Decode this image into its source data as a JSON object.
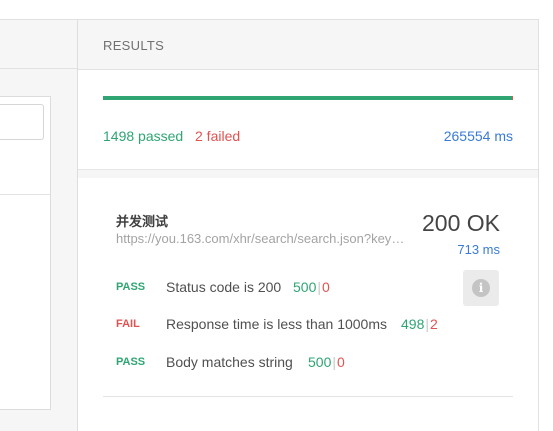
{
  "results": {
    "title": "RESULTS",
    "passed": 1498,
    "failed": 2,
    "passed_text": "1498 passed",
    "failed_text": "2 failed",
    "total_time": "265554 ms",
    "pass_fraction": 0.9987
  },
  "request": {
    "name": "并发测试",
    "url": "https://you.163.com/xhr/search/search.json?keyword=...",
    "status": "200 OK",
    "time": "713 ms",
    "tests": [
      {
        "label": "PASS",
        "name": "Status code is 200",
        "pass_count": "500",
        "fail_count": "0"
      },
      {
        "label": "FAIL",
        "name": "Response time is less than 1000ms",
        "pass_count": "498",
        "fail_count": "2"
      },
      {
        "label": "PASS",
        "name": "Body matches string",
        "pass_count": "500",
        "fail_count": "0"
      }
    ]
  },
  "icons": {
    "info": "info-icon"
  },
  "colors": {
    "pass": "#2fa574",
    "fail": "#e15252",
    "time": "#3a7bd5"
  }
}
